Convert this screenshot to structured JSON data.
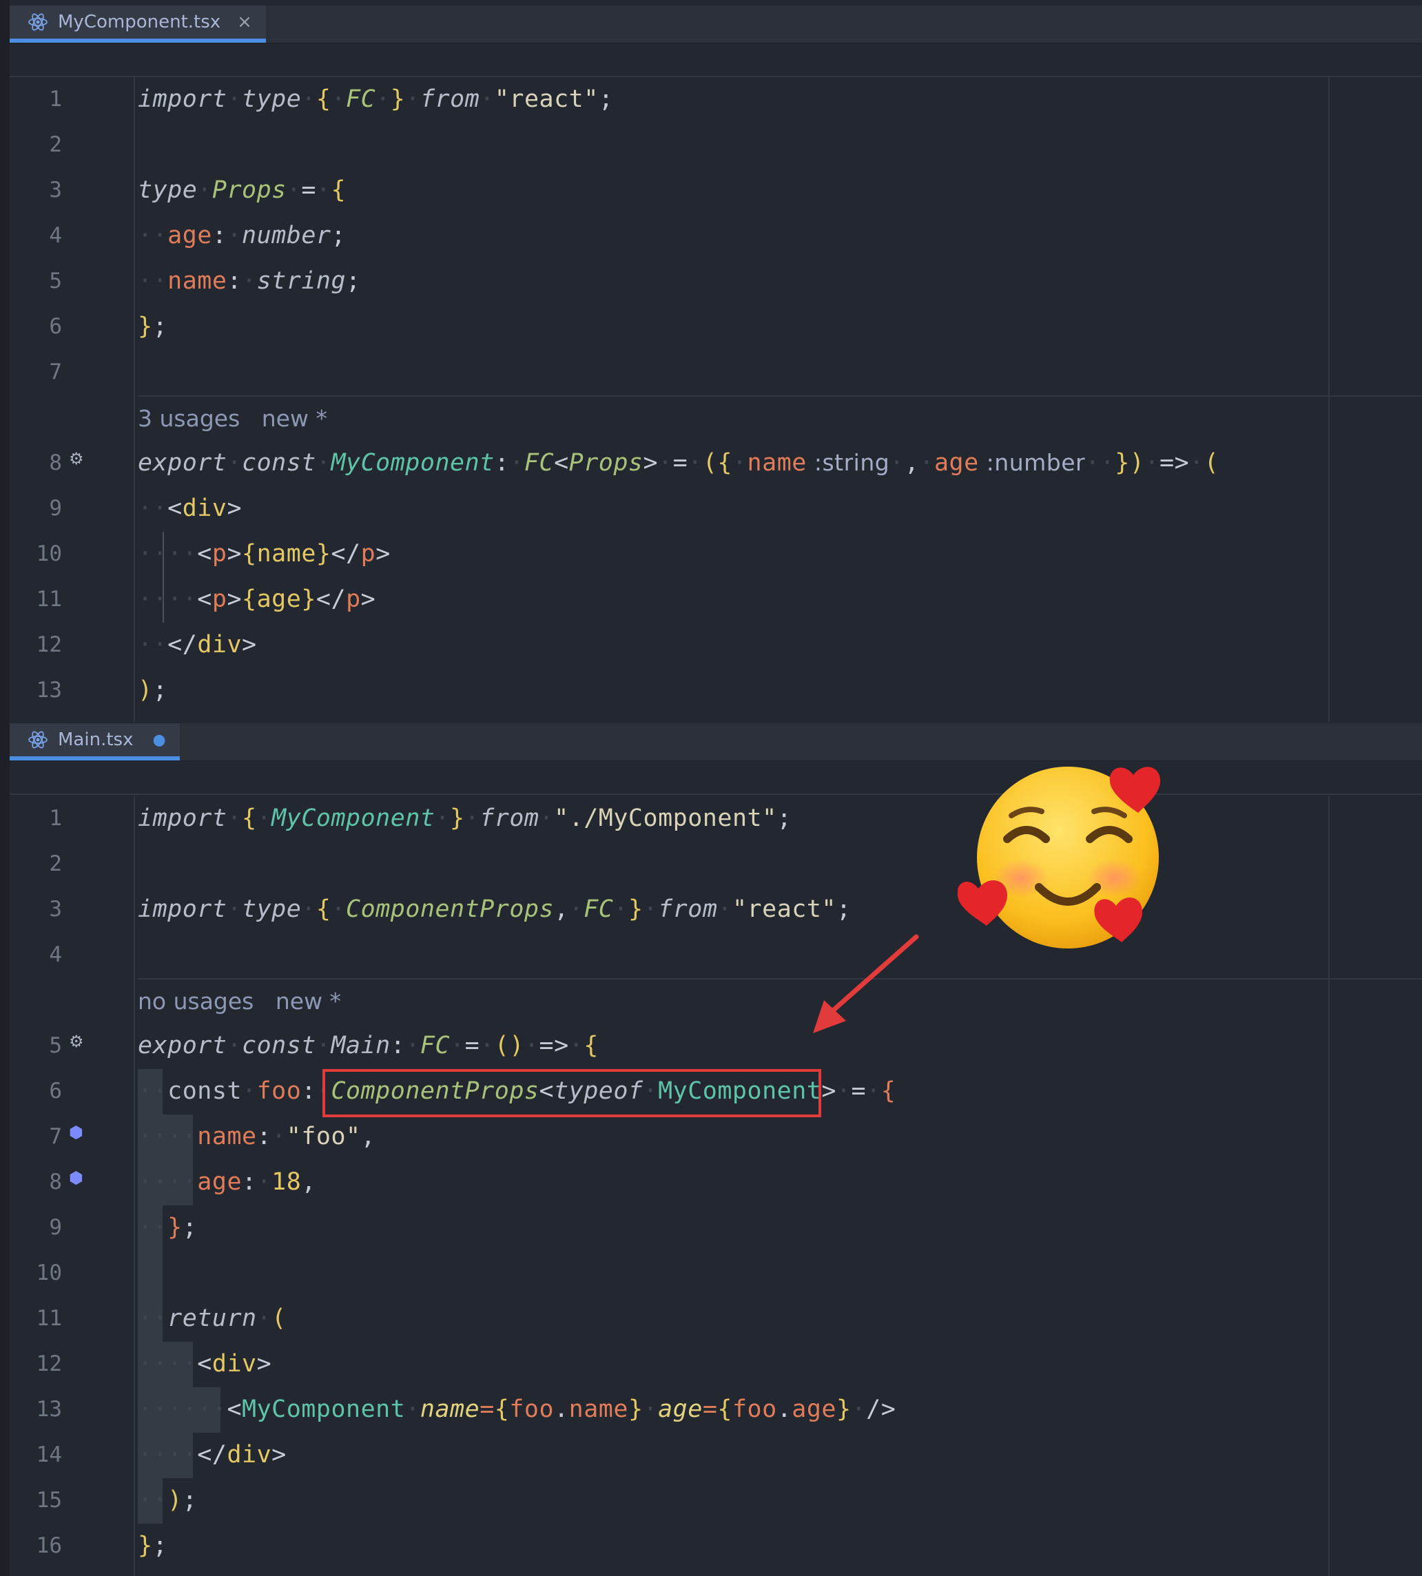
{
  "panes": [
    {
      "tab": {
        "label": "MyComponent.tsx",
        "close": "×"
      },
      "hints": [
        {
          "usages": "3 usages",
          "status": "new *"
        }
      ],
      "line_numbers": [
        "1",
        "2",
        "3",
        "4",
        "5",
        "6",
        "7",
        "8",
        "9",
        "10",
        "11",
        "12",
        "13"
      ]
    },
    {
      "tab": {
        "label": "Main.tsx",
        "modified": "●"
      },
      "hints": [
        {
          "usages": "no usages",
          "status": "new *"
        }
      ],
      "line_numbers": [
        "1",
        "2",
        "3",
        "4",
        "5",
        "6",
        "7",
        "8",
        "9",
        "10",
        "11",
        "12",
        "13",
        "14",
        "15",
        "16"
      ]
    }
  ],
  "code1": {
    "l1": [
      "import",
      "type",
      "{",
      "FC",
      "}",
      "from",
      "\"react\"",
      ";"
    ],
    "l3": [
      "type",
      "Props",
      "=",
      "{"
    ],
    "l4": [
      "age",
      ":",
      "number",
      ";"
    ],
    "l5": [
      "name",
      ":",
      "string",
      ";"
    ],
    "l6": [
      "}",
      ";"
    ],
    "l8": [
      "export",
      "const",
      "MyComponent",
      ":",
      "FC",
      "<",
      "Props",
      ">",
      "=",
      "({",
      "name",
      ":",
      "string",
      ",",
      "age",
      ":",
      "number",
      "})",
      "=>",
      "("
    ],
    "l9": [
      "<",
      "div",
      ">"
    ],
    "l10": [
      "<",
      "p",
      ">",
      "{",
      "name",
      "}",
      "</",
      "p",
      ">"
    ],
    "l11": [
      "<",
      "p",
      ">",
      "{",
      "age",
      "}",
      "</",
      "p",
      ">"
    ],
    "l12": [
      "</",
      "div",
      ">"
    ],
    "l13": [
      ")",
      ";"
    ]
  },
  "code2": {
    "l1": [
      "import",
      "{",
      "MyComponent",
      "}",
      "from",
      "\"./MyComponent\"",
      ";"
    ],
    "l3": [
      "import",
      "type",
      "{",
      "ComponentProps",
      ",",
      "FC",
      "}",
      "from",
      "\"react\"",
      ";"
    ],
    "l5": [
      "export",
      "const",
      "Main",
      ":",
      "FC",
      "=",
      "()",
      "=>",
      "{"
    ],
    "l6": [
      "const",
      "foo",
      ":",
      "ComponentProps",
      "<",
      "typeof",
      "MyComponent",
      ">",
      "=",
      "{"
    ],
    "l7": [
      "name",
      ":",
      "\"foo\"",
      ","
    ],
    "l8": [
      "age",
      ":",
      "18",
      ","
    ],
    "l9": [
      "}",
      ";"
    ],
    "l11": [
      "return",
      "("
    ],
    "l12": [
      "<",
      "div",
      ">"
    ],
    "l13": [
      "<",
      "MyComponent",
      "name",
      "=",
      "{",
      "foo",
      ".",
      "name",
      "}",
      "age",
      "=",
      "{",
      "foo",
      ".",
      "age",
      "}",
      "/>"
    ],
    "l14": [
      "</",
      "div",
      ">"
    ],
    "l15": [
      ")",
      ";"
    ],
    "l16": [
      "}",
      ";"
    ]
  },
  "icons": {
    "tab_icon": "react-atom-icon",
    "gutter_usages": "find-usages-icon",
    "gutter_impl": "implements-property-icon",
    "annotation_arrow": "red-arrow",
    "emoji": "smiling-face-with-hearts"
  },
  "colors": {
    "highlight_box": "#e23b3b",
    "tab_underline": "#4b8fe2"
  }
}
